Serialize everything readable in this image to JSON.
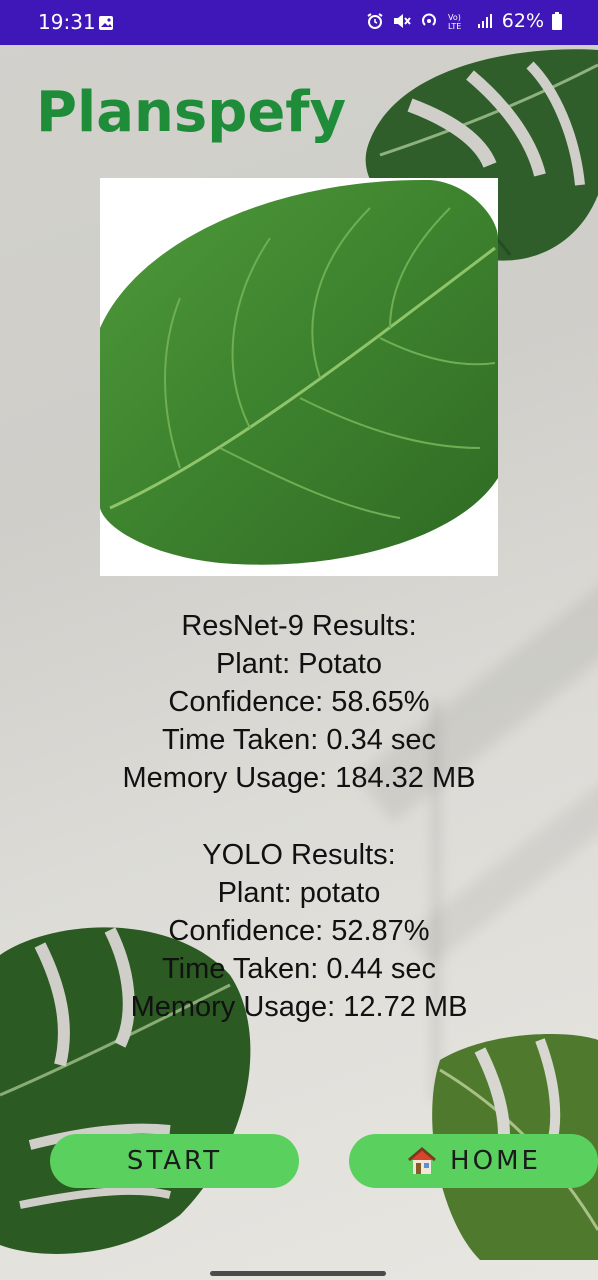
{
  "status_bar": {
    "time": "19:31",
    "battery": "62%",
    "icons": [
      "photo-icon",
      "alarm-icon",
      "mute-icon",
      "hotspot-icon",
      "volte-icon",
      "signal-icon",
      "battery-icon"
    ],
    "background": "#3f17b8"
  },
  "app": {
    "title": "Planspefy",
    "title_color": "#1f8c3a"
  },
  "image": {
    "subject": "potato leaf"
  },
  "resnet": {
    "heading": "ResNet-9 Results:",
    "plant": "Plant: Potato",
    "confidence": "Confidence: 58.65%",
    "time_taken": "Time Taken: 0.34 sec",
    "memory": "Memory Usage: 184.32 MB"
  },
  "yolo": {
    "heading": "YOLO Results:",
    "plant": "Plant: potato",
    "confidence": "Confidence: 52.87%",
    "time_taken": "Time Taken: 0.44 sec",
    "memory": "Memory Usage: 12.72 MB"
  },
  "buttons": {
    "start_label": "START",
    "home_label": "HOME",
    "button_color": "#5ad15e"
  }
}
